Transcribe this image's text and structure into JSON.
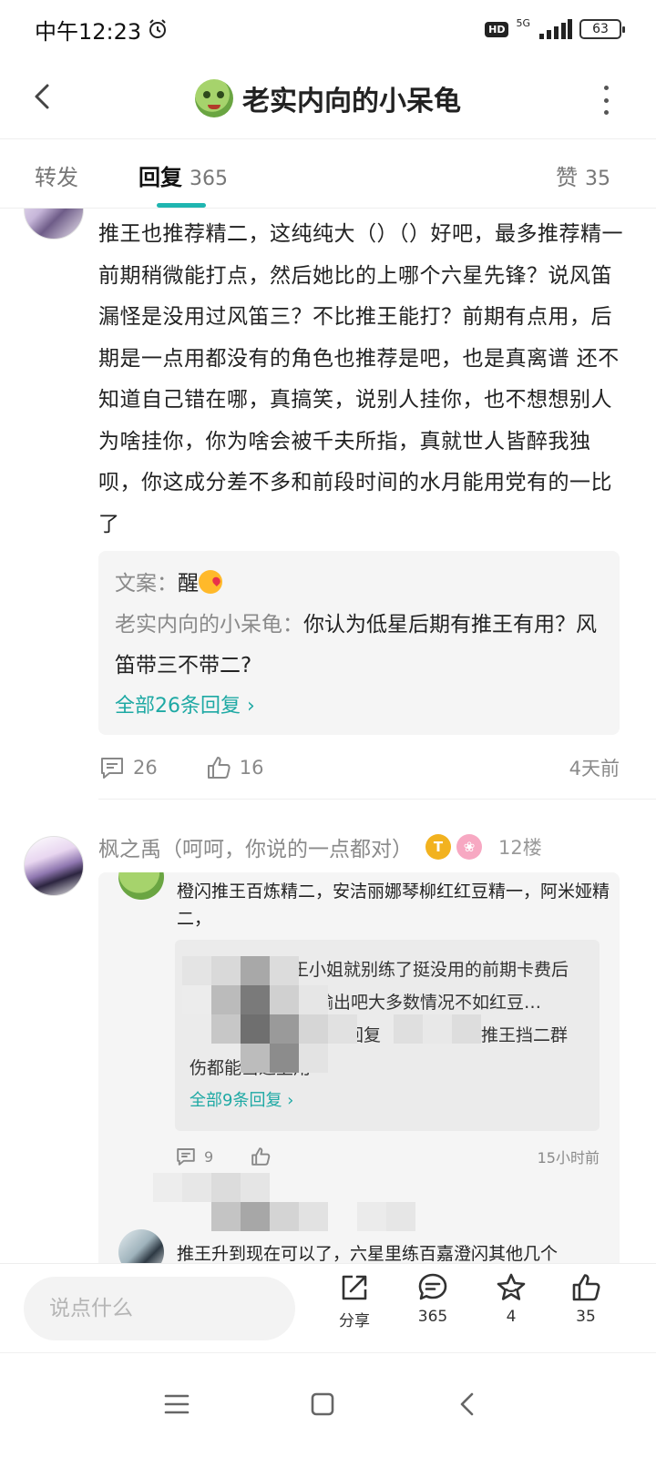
{
  "status_bar": {
    "time": "中午12:23",
    "hd": "HD",
    "network": "5G",
    "battery": "63"
  },
  "nav": {
    "title": "老实内向的小呆龟"
  },
  "tabs": {
    "repost_label": "转发",
    "reply_label": "回复",
    "reply_count": "365",
    "like_label": "赞",
    "like_count": "35"
  },
  "post1": {
    "body": "推王也推荐精二，这纯纯大（）（）好吧，最多推荐精一前期稍微能打点，然后她比的上哪个六星先锋？说风笛漏怪是没用过风笛三？不比推王能打？前期有点用，后期是一点用都没有的角色也推荐是吧，也是真离谱 还不知道自己错在哪，真搞笑，说别人挂你，也不想想别人为啥挂你，你为啥会被千夫所指，真就世人皆醉我独呗，你这成分差不多和前段时间的水月能用党有的一比了",
    "quotes": [
      {
        "name": "文案",
        "sep": "：",
        "text": "醒"
      },
      {
        "name": "老实内向的小呆龟",
        "sep": "：",
        "text": "你认为低星后期有推王有用？风笛带三不带二?"
      }
    ],
    "all_replies": "全部26条回复 ›",
    "comment_count": "26",
    "like_count": "16",
    "time": "4天前"
  },
  "post2": {
    "username": "枫之禹（呵呵，你说的一点都对）",
    "badge_gold": "T",
    "floor": "12楼",
    "sub1_text": "橙闪推王百炼精二，安洁丽娜琴柳红红豆精一，阿米娅精二，",
    "nested_line1": "王小姐就别练了挺没用的前期卡费后",
    "nested_line2": "期间费操  你说要输出吧大多数情况不如红豆…",
    "nested_line3_a": "回复",
    "nested_line3_b": "推王挡二群",
    "nested_line4": "伤都能当近卫用",
    "nested_all_replies": "全部9条回复 ›",
    "sub1_comment_count": "9",
    "sub1_time": "15小时前",
    "sub2_text": "推王升到现在可以了，六星里练百嘉澄闪其他几个"
  },
  "bottom_bar": {
    "input_placeholder": "说点什么",
    "share_label": "分享",
    "comment_count": "365",
    "star_count": "4",
    "like_count": "35"
  },
  "colors": {
    "accent": "#1fb5b0",
    "link": "#1ea9a4",
    "muted_text": "#8a8a8a"
  }
}
